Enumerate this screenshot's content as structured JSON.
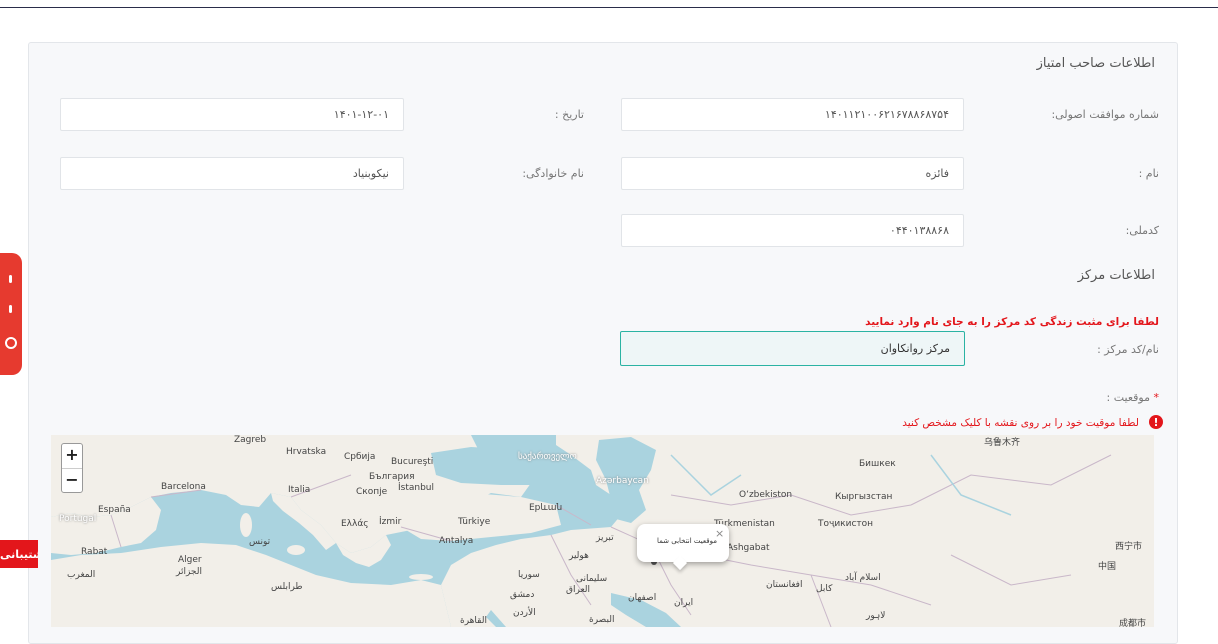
{
  "owner_section": {
    "title": "اطلاعات صاحب امتیاز",
    "approval_label": "شماره موافقت اصولی:",
    "approval_value": "۱۴۰۱۱۲۱۰۰۶۲۱۶۷۸۸۶۸۷۵۴",
    "date_label": "تاریخ :",
    "date_value": "۱۴۰۱-۱۲-۰۱",
    "name_label": "نام :",
    "name_value": "فائزه",
    "family_label": "نام خانوادگی:",
    "family_value": "نیکوبنیاد",
    "national_code_label": "کدملی:",
    "national_code_value": "۰۴۴۰۱۳۸۸۶۸"
  },
  "center_section": {
    "title": "اطلاعات مرکز",
    "warning": "لطفا برای مثبت زندگی کد مرکز را به جای نام وارد نمایید",
    "center_label": "نام/کد مرکز :",
    "center_value": "مرکز روانکاوان",
    "location_label": "موقعیت :",
    "location_required": "*",
    "map_instruction": "لطفا موقیت خود را بر روی نقشه با کلیک مشخص کنید",
    "info_icon": "!"
  },
  "map": {
    "zoom_in": "+",
    "zoom_out": "−",
    "popup_text": "موقعیت انتخابی شما",
    "popup_close": "×",
    "labels": [
      "Zagreb",
      "Hrvatska",
      "Србија",
      "Bucureşti",
      "България",
      "Barcelona",
      "Italia",
      "Скопје",
      "İstanbul",
      "Portugal",
      "España",
      "Ελλάς",
      "İzmir",
      "Türkiye",
      "Antalya",
      "საქართველო",
      "Azərbaycan",
      "Ерևան",
      "Rabat",
      "المغرب",
      "Alger",
      "الجزائر",
      "تونس",
      "طرابلس",
      "دمشق",
      "سوريا",
      "العراق",
      "القاهرة",
      "الأردن",
      "اصفهان",
      "ایران",
      "البصرة",
      "Türkmenistan",
      "Ashgabat",
      "Oʻzbekiston",
      "Бишкек",
      "Кыргызстан",
      "Тоҷикистон",
      "乌鲁木齐",
      "西宁市",
      "中国",
      "成都市",
      "کابل",
      "افغانستان",
      "اسلام آباد",
      "لاہور",
      "تبریز",
      "هولیر",
      "سلیمانی"
    ]
  },
  "side": {
    "support_label": "پشتیبانی",
    "tab_icon": "chat-icon"
  },
  "colors": {
    "warning_red": "#e3161b",
    "focus_teal": "#2bb3a3",
    "side_tab_red": "#e63a2f"
  }
}
